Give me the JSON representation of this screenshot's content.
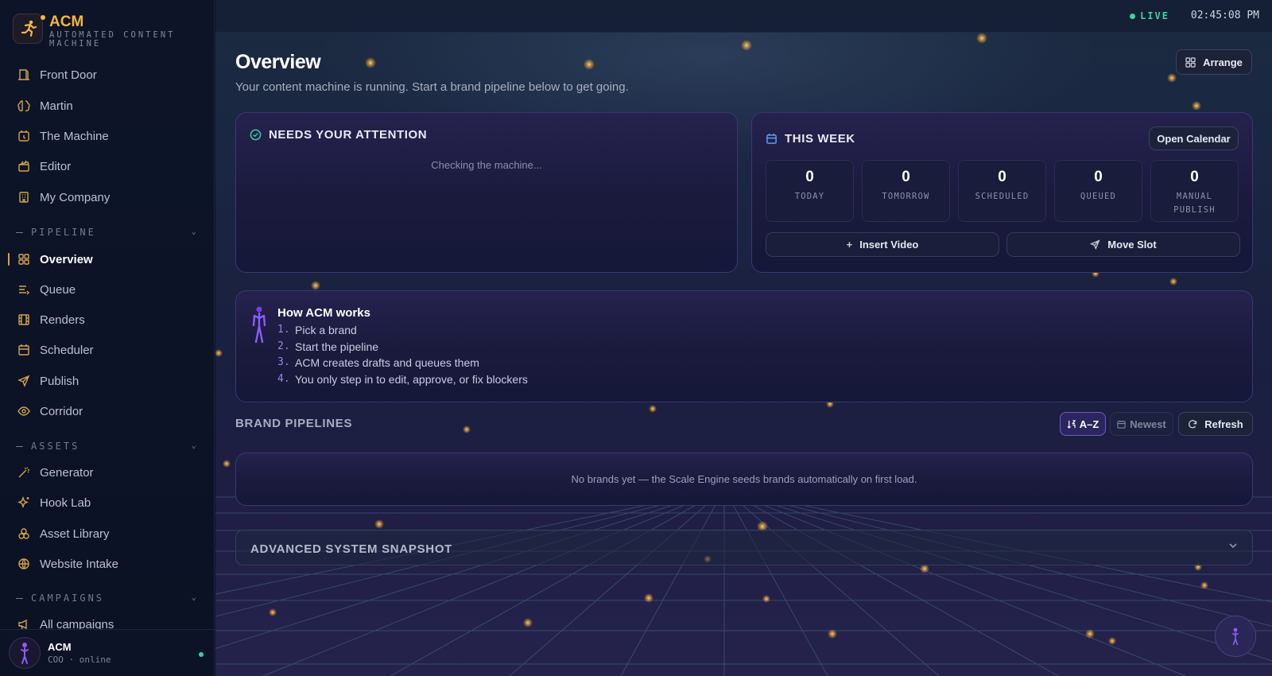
{
  "brand": {
    "name": "ACM",
    "subtitle": "AUTOMATED CONTENT MACHINE"
  },
  "sidebar": {
    "top_items": [
      {
        "label": "Front Door",
        "icon": "door-icon"
      },
      {
        "label": "Martin",
        "icon": "brain-icon"
      },
      {
        "label": "The Machine",
        "icon": "clock-icon"
      },
      {
        "label": "Editor",
        "icon": "clapper-icon"
      },
      {
        "label": "My Company",
        "icon": "building-icon"
      }
    ],
    "sections": [
      {
        "label": "PIPELINE",
        "items": [
          {
            "label": "Overview",
            "icon": "grid-icon",
            "active": true
          },
          {
            "label": "Queue",
            "icon": "list-icon"
          },
          {
            "label": "Renders",
            "icon": "film-icon"
          },
          {
            "label": "Scheduler",
            "icon": "calendar-icon"
          },
          {
            "label": "Publish",
            "icon": "send-icon"
          },
          {
            "label": "Corridor",
            "icon": "eye-icon"
          }
        ]
      },
      {
        "label": "ASSETS",
        "items": [
          {
            "label": "Generator",
            "icon": "wand-icon"
          },
          {
            "label": "Hook Lab",
            "icon": "sparkle-icon"
          },
          {
            "label": "Asset Library",
            "icon": "layers-icon"
          },
          {
            "label": "Website Intake",
            "icon": "globe-icon"
          }
        ]
      },
      {
        "label": "CAMPAIGNS",
        "items": [
          {
            "label": "All campaigns",
            "icon": "megaphone-icon"
          }
        ]
      }
    ]
  },
  "user": {
    "name": "ACM",
    "status": "COO · online"
  },
  "topbar": {
    "live_label": "LIVE",
    "clock": "02:45:08 PM"
  },
  "page": {
    "title": "Overview",
    "subtitle": "Your content machine is running. Start a brand pipeline below to get going.",
    "arrange_label": "Arrange"
  },
  "attention": {
    "title": "NEEDS YOUR ATTENTION",
    "status": "Checking the machine..."
  },
  "week": {
    "title": "THIS WEEK",
    "open_calendar": "Open Calendar",
    "stats": [
      {
        "value": "0",
        "label": "TODAY"
      },
      {
        "value": "0",
        "label": "TOMORROW"
      },
      {
        "value": "0",
        "label": "SCHEDULED"
      },
      {
        "value": "0",
        "label": "QUEUED"
      },
      {
        "value": "0",
        "label": "MANUAL PUBLISH"
      }
    ],
    "insert_video": "Insert Video",
    "move_slot": "Move Slot"
  },
  "how": {
    "title": "How ACM works",
    "steps": [
      {
        "n": "1.",
        "text": "Pick a brand"
      },
      {
        "n": "2.",
        "text": "Start the pipeline"
      },
      {
        "n": "3.",
        "text": "ACM creates drafts and queues them"
      },
      {
        "n": "4.",
        "text": "You only step in to edit, approve, or fix blockers"
      }
    ]
  },
  "pipelines": {
    "title": "BRAND PIPELINES",
    "sort_az": "A–Z",
    "sort_newest": "Newest",
    "refresh": "Refresh",
    "empty": "No brands yet — the Scale Engine seeds brands automatically on first load."
  },
  "snapshot": {
    "title": "ADVANCED SYSTEM SNAPSHOT"
  },
  "colors": {
    "accent": "#d4a349",
    "brand": "#f3b73e",
    "live": "#39d3a0",
    "purple": "#9c84e4"
  }
}
